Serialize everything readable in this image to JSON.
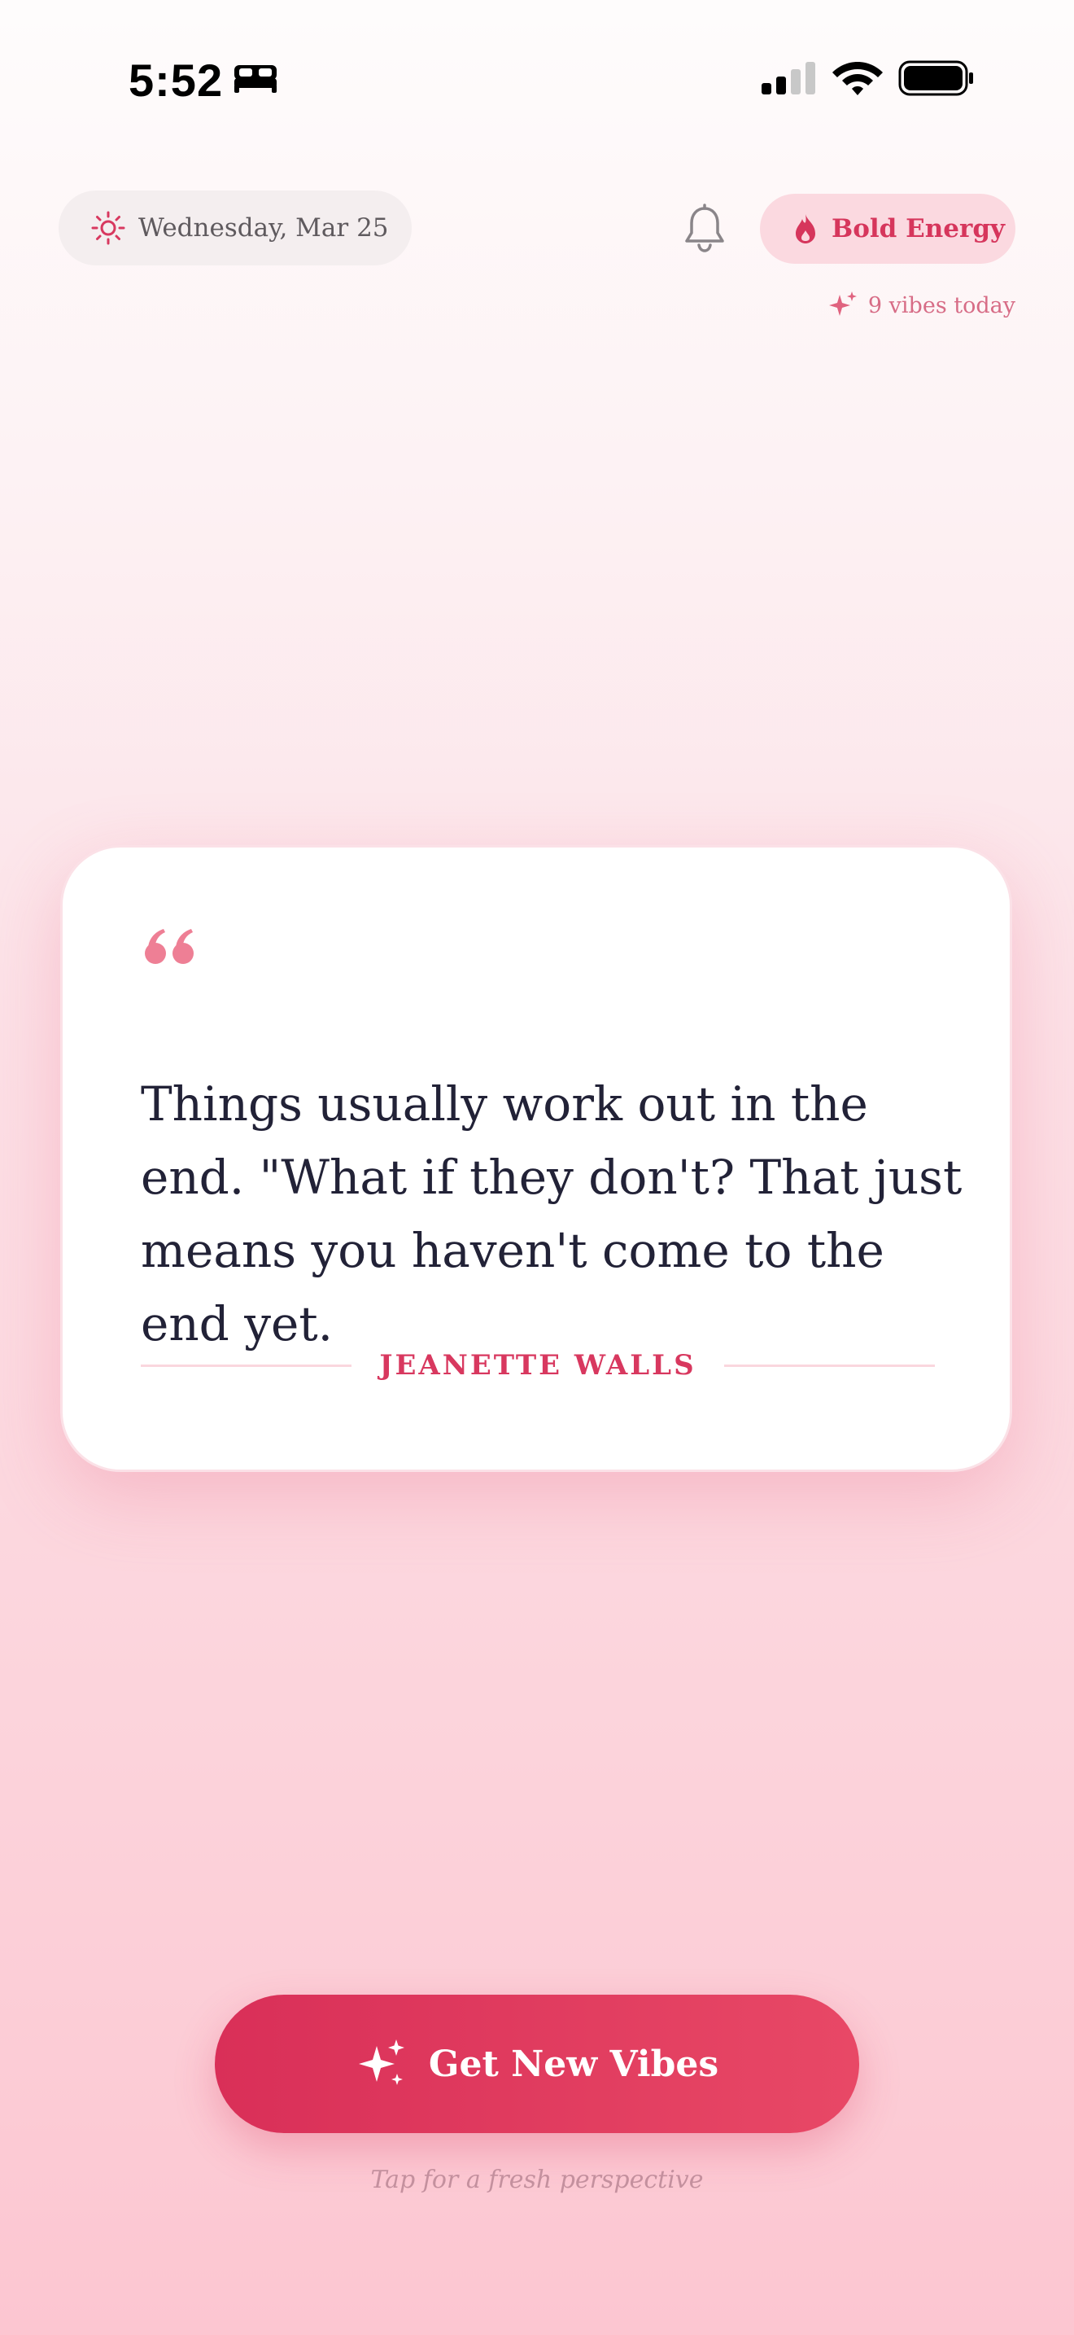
{
  "status_bar": {
    "time": "5:52"
  },
  "header": {
    "date": "Wednesday, Mar 25",
    "energy_label": "Bold Energy",
    "vibes_count": "9 vibes today"
  },
  "quote": {
    "text": "Things usually work out in the end. \"What if they don't? That just means you haven't come to the end yet.",
    "author": "JEANETTE WALLS"
  },
  "cta": {
    "label": "Get New Vibes",
    "hint": "Tap for a fresh perspective"
  },
  "colors": {
    "accent": "#d8385f",
    "energy_pill_bg": "#fbd9e0",
    "date_pill_bg": "#f4eeef",
    "quote_text": "#222237"
  },
  "icons": {
    "status": [
      "bed-icon",
      "signal-icon",
      "wifi-icon",
      "battery-icon"
    ],
    "header": [
      "sun-icon",
      "bell-icon",
      "flame-icon",
      "sparkle-icon"
    ],
    "quote": "quote-mark-icon",
    "cta": "sparkles-icon"
  }
}
